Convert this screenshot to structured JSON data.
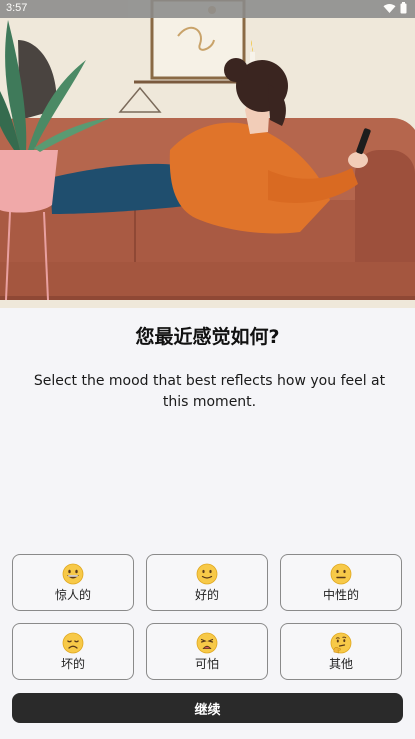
{
  "status_bar": {
    "time": "3:57",
    "icons": [
      "wifi-icon",
      "battery-icon"
    ]
  },
  "hero": {
    "illustration": "woman-on-sofa-with-phone"
  },
  "question": {
    "title": "您最近感觉如何?",
    "subtitle": "Select the mood that best reflects how you feel at this moment."
  },
  "moods": [
    {
      "label": "惊人的",
      "icon": "grinning-face-icon"
    },
    {
      "label": "好的",
      "icon": "slightly-smiling-face-icon"
    },
    {
      "label": "中性的",
      "icon": "neutral-face-icon"
    },
    {
      "label": "坏的",
      "icon": "disappointed-face-icon"
    },
    {
      "label": "可怕",
      "icon": "weary-face-icon"
    },
    {
      "label": "其他",
      "icon": "thinking-face-icon"
    }
  ],
  "continue_button": {
    "label": "继续"
  },
  "colors": {
    "background": "#f5f5f8",
    "button_dark": "#2a2a2a",
    "sofa": "#b5664d",
    "emoji_yellow": "#f7c948"
  }
}
